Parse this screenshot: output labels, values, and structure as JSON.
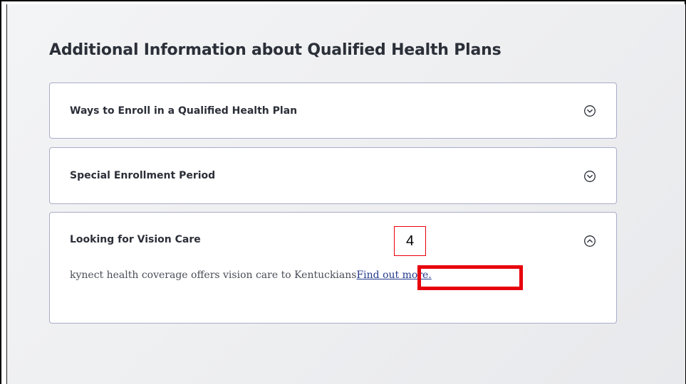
{
  "heading": "Additional Information about Qualified Health Plans",
  "accordions": [
    {
      "title": "Ways to Enroll in a Qualified Health Plan",
      "icon": "chevron-down-circle-icon",
      "expanded": false
    },
    {
      "title": "Special Enrollment Period",
      "icon": "chevron-down-circle-icon",
      "expanded": false
    },
    {
      "title": "Looking for Vision Care",
      "icon": "chevron-up-circle-icon",
      "expanded": true,
      "body_text": "kynect health coverage offers vision care to Kentuckians",
      "link_text": "Find out more."
    }
  ],
  "annotation": {
    "step_number": "4",
    "color": "#e8000c"
  }
}
